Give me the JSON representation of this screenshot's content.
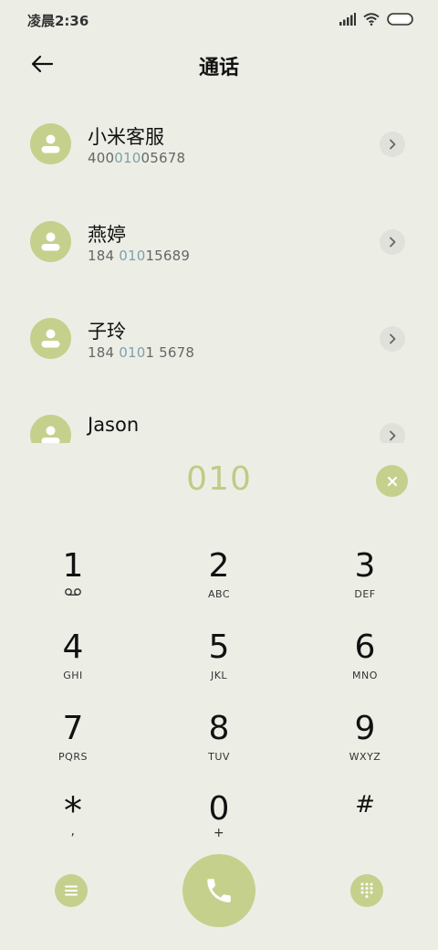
{
  "status_bar": {
    "time": "凌晨2:36",
    "icons": [
      "signal-icon",
      "wifi-icon",
      "battery-icon"
    ]
  },
  "header": {
    "title": "通话",
    "back_icon": "back-arrow-icon"
  },
  "contacts": [
    {
      "name": "小米客服",
      "number_before": "400",
      "number_match": "010",
      "number_after": "05678"
    },
    {
      "name": "燕婷",
      "number_before": "184 ",
      "number_match": "010",
      "number_after": "15689"
    },
    {
      "name": "子玲",
      "number_before": "184 ",
      "number_match": "010",
      "number_after": "1 5678"
    },
    {
      "name": "Jason",
      "number_before": "",
      "number_match": "",
      "number_after": ""
    }
  ],
  "dial_input": {
    "value": "010"
  },
  "keypad": {
    "keys": [
      {
        "digit": "1",
        "letters": ""
      },
      {
        "digit": "2",
        "letters": "ABC"
      },
      {
        "digit": "3",
        "letters": "DEF"
      },
      {
        "digit": "4",
        "letters": "GHI"
      },
      {
        "digit": "5",
        "letters": "JKL"
      },
      {
        "digit": "6",
        "letters": "MNO"
      },
      {
        "digit": "7",
        "letters": "PQRS"
      },
      {
        "digit": "8",
        "letters": "TUV"
      },
      {
        "digit": "9",
        "letters": "WXYZ"
      },
      {
        "digit": "*",
        "letters": ","
      },
      {
        "digit": "0",
        "letters": "+"
      },
      {
        "digit": "#",
        "letters": ""
      }
    ]
  },
  "colors": {
    "accent": "#c5d08d",
    "background": "#eceee6",
    "highlight": "#7fa0aa"
  },
  "bottom_bar": {
    "menu_icon": "menu-icon",
    "call_icon": "phone-icon",
    "keypad_icon": "dialpad-icon"
  }
}
